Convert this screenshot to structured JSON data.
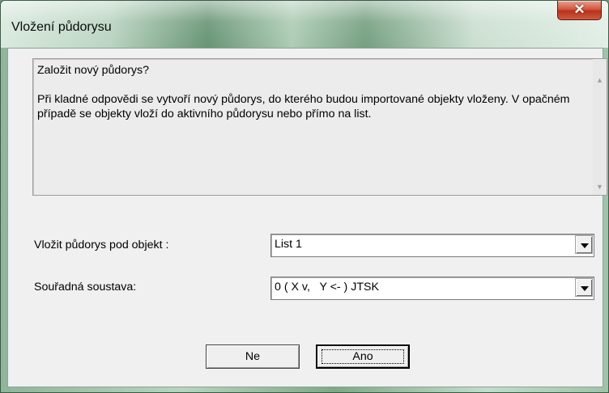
{
  "window": {
    "title": "Vložení půdorysu",
    "close_icon": "close-icon"
  },
  "message": {
    "line1": "Založit nový půdorys?",
    "paragraph": "Při kladné odpovědi se vytvoří nový půdorys, do kterého budou importované objekty vloženy. V opačném případě se objekty vloží do aktivního půdorysu nebo přímo na list.",
    "scroll_up_icon": "scroll-up-arrow-icon",
    "scroll_down_icon": "scroll-down-arrow-icon"
  },
  "fields": {
    "insert_under": {
      "label": "Vložit půdorys pod objekt :",
      "value": "List 1"
    },
    "coordinate_system": {
      "label": "Souřadná soustava:",
      "value": "0 ( X v,   Y <- ) JTSK"
    }
  },
  "buttons": {
    "no": "Ne",
    "yes": "Ano"
  },
  "colors": {
    "close_button": "#c8442c",
    "dialog_background": "#f0f0f0"
  }
}
